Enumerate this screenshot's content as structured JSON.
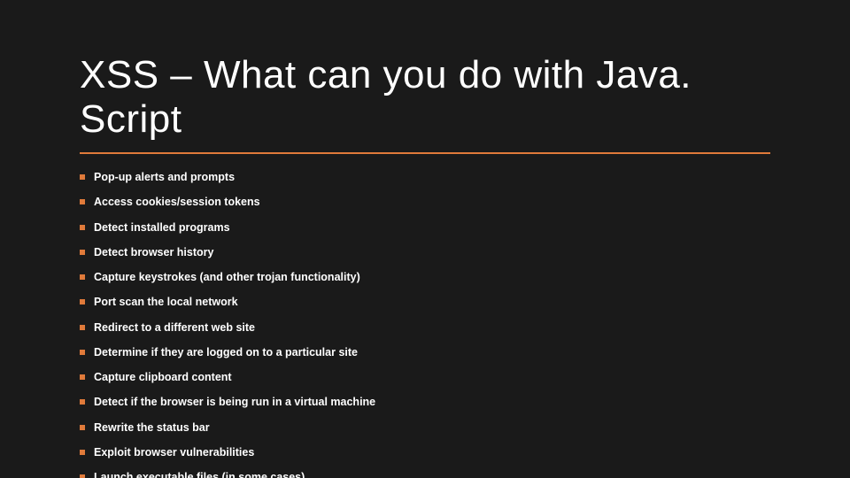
{
  "slide": {
    "title": "XSS – What can you do with Java. Script",
    "accent_color": "#e07a3a",
    "bullets": [
      "Pop-up alerts and prompts",
      "Access cookies/session tokens",
      "Detect installed programs",
      "Detect browser history",
      "Capture keystrokes (and other trojan functionality)",
      "Port scan the local network",
      "Redirect to a different web site",
      "Determine if they are logged on to a particular site",
      "Capture clipboard content",
      "Detect if the browser is being run in a virtual machine",
      "Rewrite the status bar",
      "Exploit browser vulnerabilities",
      "Launch executable files (in some cases)"
    ]
  }
}
